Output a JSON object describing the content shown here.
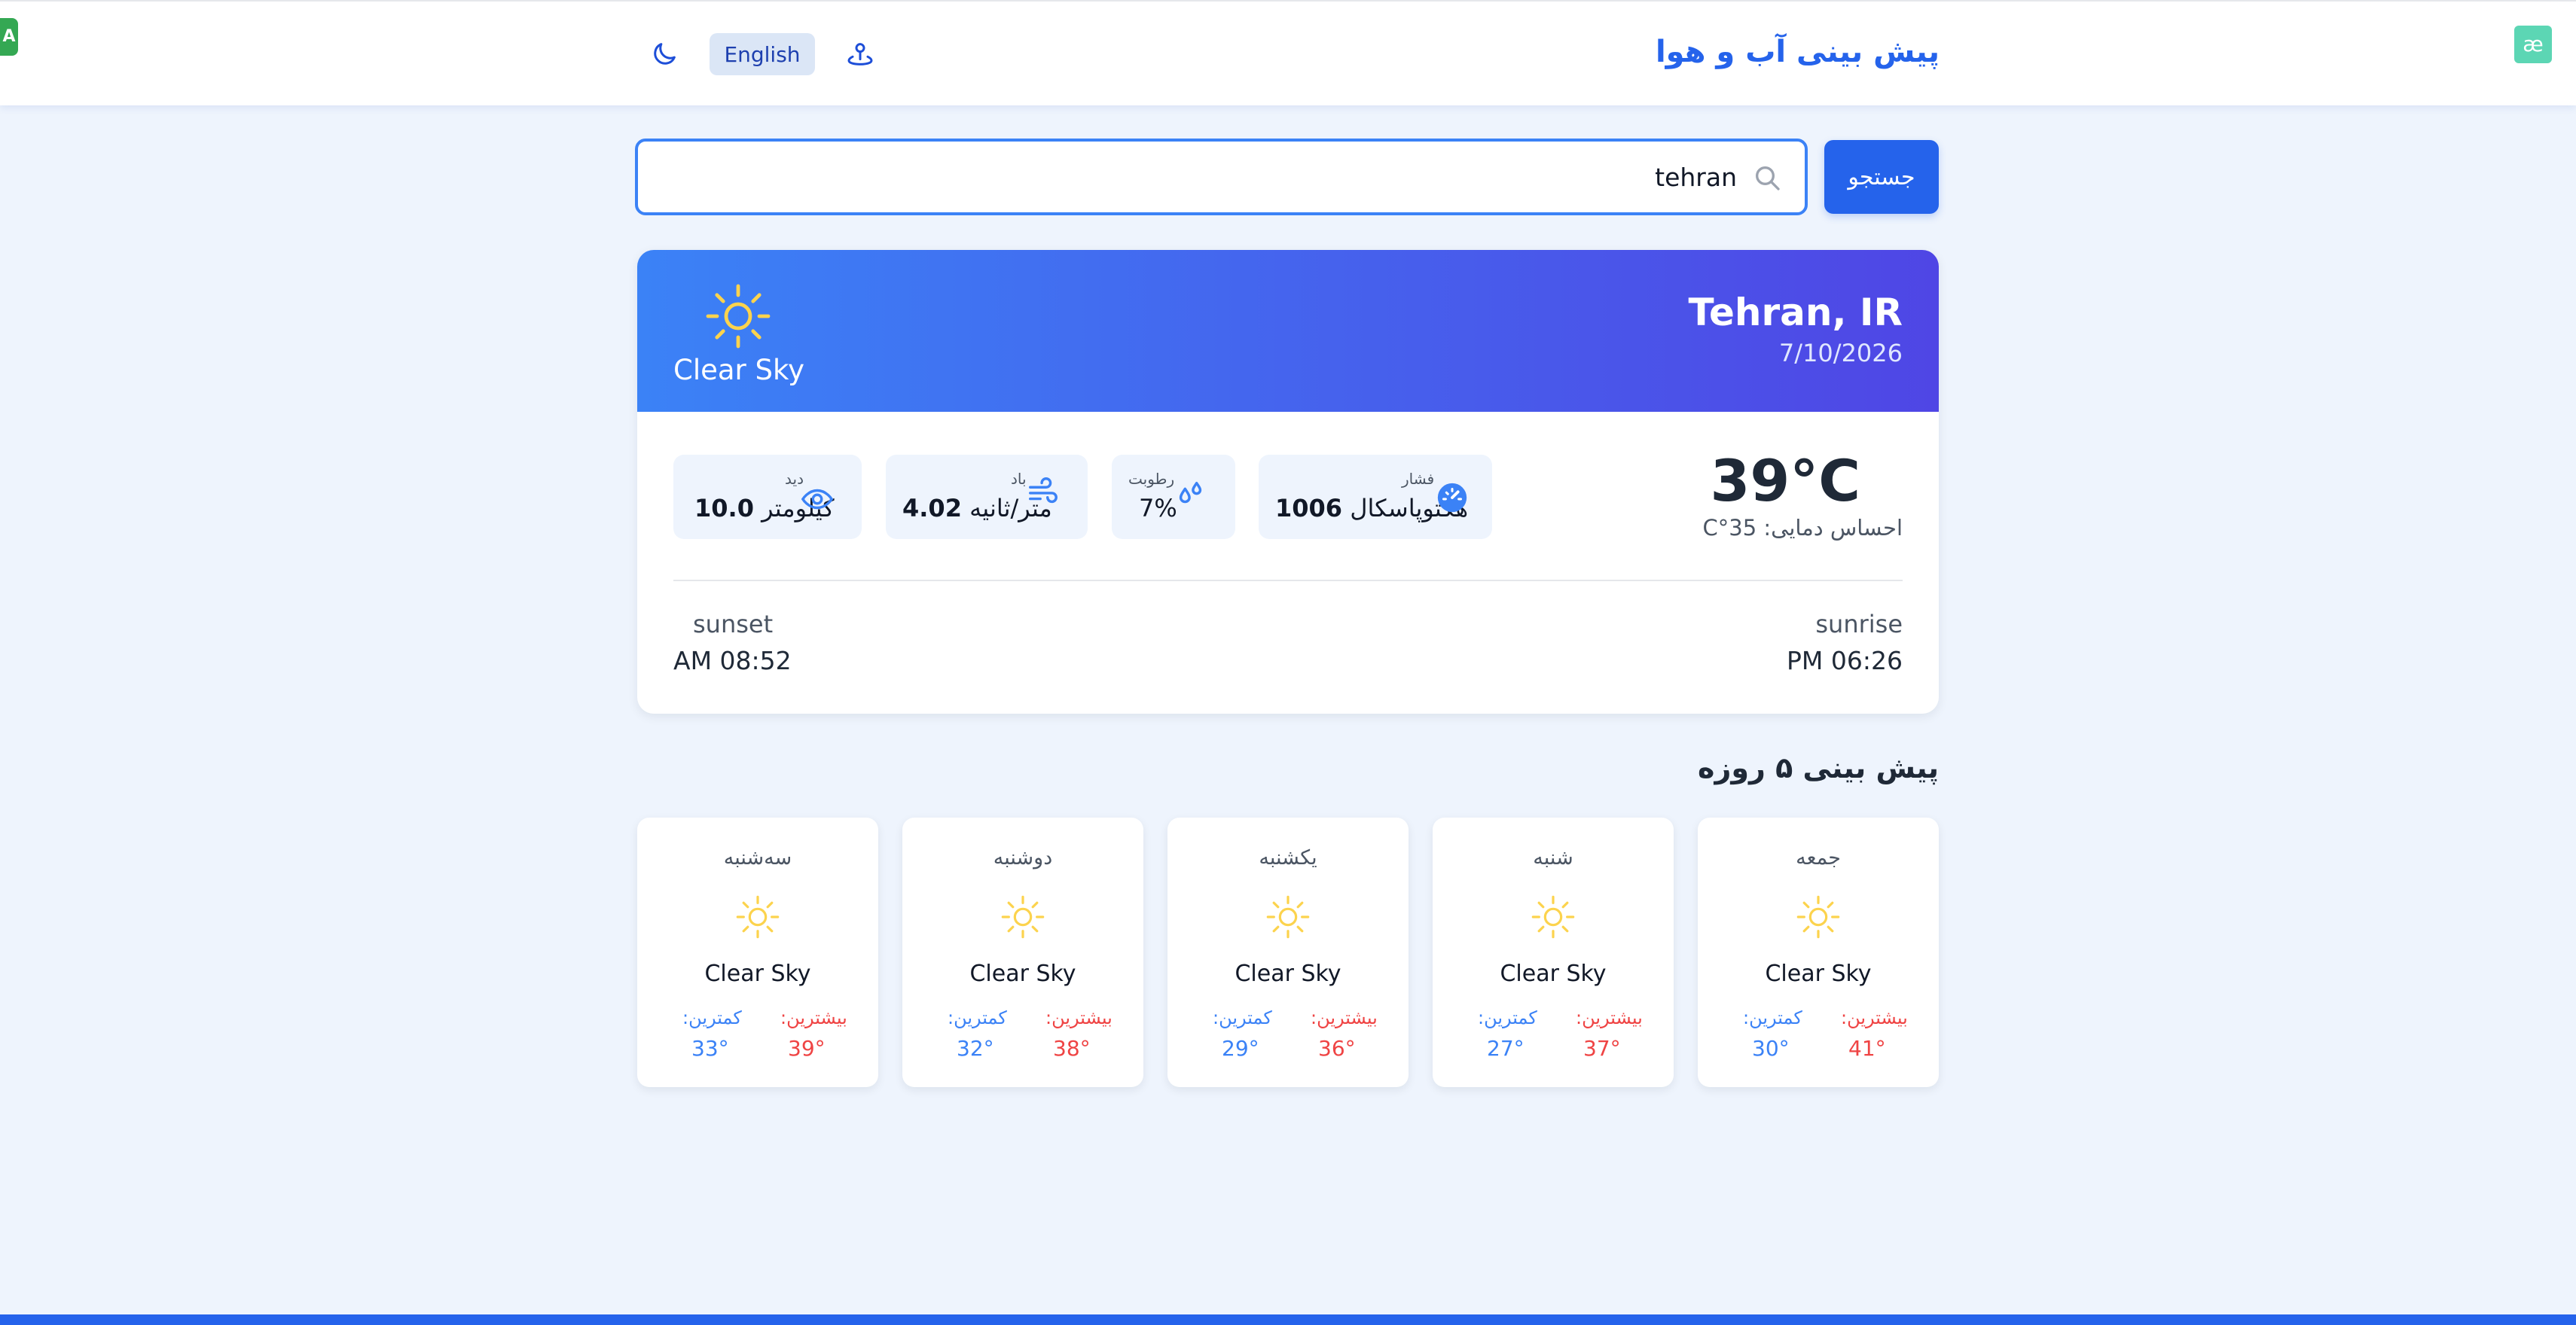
{
  "header": {
    "title": "پیش بینی آب و هوا",
    "language_button": "English",
    "left_badge": "A",
    "right_badge": "æ"
  },
  "search": {
    "value": "tehran",
    "button_label": "جستجو"
  },
  "current": {
    "city": "Tehran, IR",
    "date": "7/10/2026",
    "condition": "Clear Sky",
    "temperature": "39°C",
    "feels_like": "احساس دمایی: 35°C",
    "stats": {
      "pressure": {
        "label": "فشار",
        "value": "1006",
        "unit": "هکتوپاسکال"
      },
      "humidity": {
        "label": "رطوبت",
        "value": "7%"
      },
      "wind": {
        "label": "باد",
        "value": "4.02",
        "unit": "متر/ثانیه"
      },
      "visibility": {
        "label": "دید",
        "value": "10.0",
        "unit": "کیلومتر"
      }
    },
    "sunrise": {
      "label": "sunrise",
      "value": "PM 06:26"
    },
    "sunset": {
      "label": "sunset",
      "value": "AM 08:52"
    }
  },
  "forecast": {
    "title": "پیش بینی ۵ روزه",
    "max_label": "بیشترین:",
    "min_label": "کمترین:",
    "days": [
      {
        "day": "جمعه",
        "condition": "Clear Sky",
        "max": "41°",
        "min": "30°"
      },
      {
        "day": "شنبه",
        "condition": "Clear Sky",
        "max": "37°",
        "min": "27°"
      },
      {
        "day": "یکشنبه",
        "condition": "Clear Sky",
        "max": "36°",
        "min": "29°"
      },
      {
        "day": "دوشنبه",
        "condition": "Clear Sky",
        "max": "38°",
        "min": "32°"
      },
      {
        "day": "سه‌شنبه",
        "condition": "Clear Sky",
        "max": "39°",
        "min": "33°"
      }
    ]
  },
  "colors": {
    "accent": "#2563eb",
    "hero_start": "#3b82f6",
    "hero_end": "#4f46e5",
    "max_temp": "#ef4444",
    "min_temp": "#3b82f6",
    "sun_icon": "#fbbf24"
  }
}
